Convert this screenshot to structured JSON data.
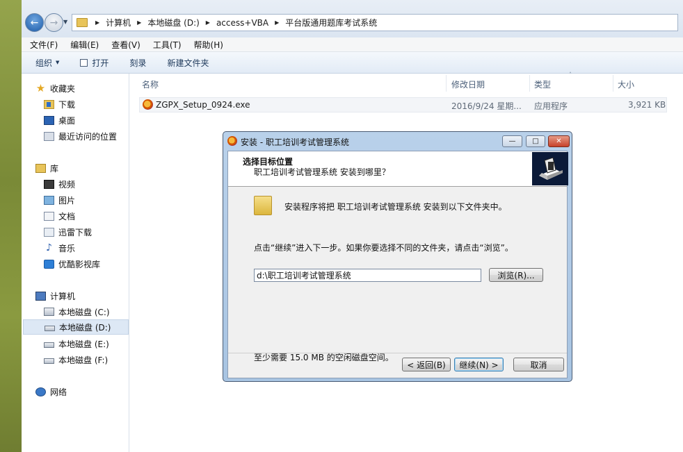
{
  "explorer": {
    "breadcrumbs": [
      "计算机",
      "本地磁盘 (D:)",
      "access+VBA",
      "平台版通用题库考试系统"
    ],
    "menu": [
      "文件(F)",
      "编辑(E)",
      "查看(V)",
      "工具(T)",
      "帮助(H)"
    ],
    "toolbar": {
      "organize": "组织",
      "open": "打开",
      "burn": "刻录",
      "new_folder": "新建文件夹"
    },
    "sidebar": {
      "favorites": {
        "label": "收藏夹",
        "items": [
          "下载",
          "桌面",
          "最近访问的位置"
        ]
      },
      "libraries": {
        "label": "库",
        "items": [
          "视频",
          "图片",
          "文档",
          "迅雷下载",
          "音乐",
          "优酷影视库"
        ]
      },
      "computer": {
        "label": "计算机",
        "items": [
          "本地磁盘 (C:)",
          "本地磁盘 (D:)",
          "本地磁盘 (E:)",
          "本地磁盘 (F:)"
        ],
        "selected": "本地磁盘 (D:)"
      },
      "network": {
        "label": "网络"
      }
    },
    "columns": {
      "name": "名称",
      "date": "修改日期",
      "type": "类型",
      "size": "大小"
    },
    "files": [
      {
        "name": "ZGPX_Setup_0924.exe",
        "date": "2016/9/24 星期...",
        "type": "应用程序",
        "size": "3,921 KB"
      }
    ]
  },
  "dialog": {
    "title": "安装 - 职工培训考试管理系统",
    "header_title": "选择目标位置",
    "header_subtitle": "职工培训考试管理系统 安装到哪里？",
    "info": "安装程序将把 职工培训考试管理系统 安装到以下文件夹中。",
    "instruction": "点击“继续”进入下一步。如果你要选择不同的文件夹，请点击“浏览”。",
    "path": "d:\\职工培训考试管理系统",
    "browse": "浏览(R)...",
    "space": "至少需要 15.0 MB 的空闲磁盘空间。",
    "back": "< 返回(B)",
    "next": "继续(N) >",
    "cancel": "取消"
  }
}
